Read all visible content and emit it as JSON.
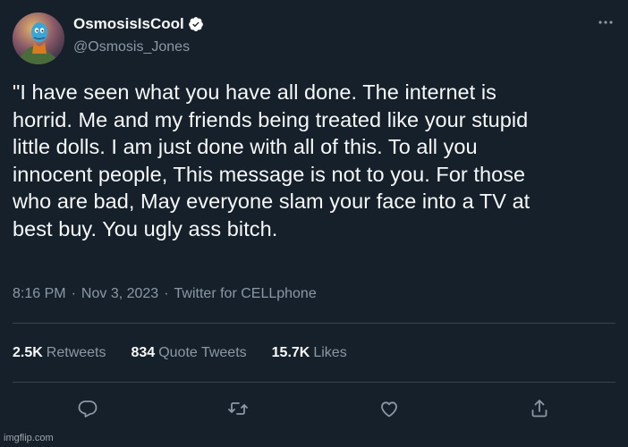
{
  "author": {
    "display_name": "OsmosisIsCool",
    "handle": "@Osmosis_Jones",
    "verified": true,
    "verified_color": "#ffffff"
  },
  "tweet": {
    "text": "\"I have seen what you have all done. The internet is\nhorrid. Me and my friends being treated like your stupid\nlittle dolls. I am just done with all of this. To all you\ninnocent people, This message is not to you. For those\nwho are bad, May everyone slam your face into a TV at\nbest buy. You ugly ass bitch.",
    "time": "8:16 PM",
    "date": "Nov 3, 2023",
    "separator": "·",
    "source": "Twitter for CELLphone"
  },
  "stats": {
    "retweets": {
      "count": "2.5K",
      "label": "Retweets"
    },
    "quotes": {
      "count": "834",
      "label": "Quote Tweets"
    },
    "likes": {
      "count": "15.7K",
      "label": "Likes"
    }
  },
  "actions": [
    "reply-icon",
    "retweet-icon",
    "like-icon",
    "share-icon"
  ],
  "watermark": "imgflip.com",
  "colors": {
    "background": "#15202b",
    "text": "#f7f9f9",
    "secondary": "#8b98a5",
    "divider": "#38444d"
  }
}
